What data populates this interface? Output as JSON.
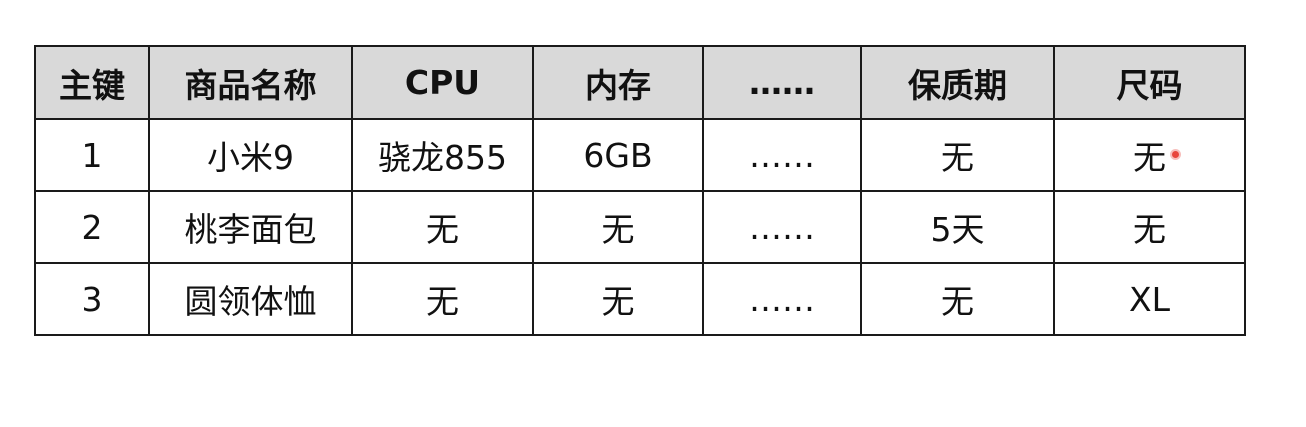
{
  "table": {
    "headers": [
      "主键",
      "商品名称",
      "CPU",
      "内存",
      "……",
      "保质期",
      "尺码"
    ],
    "rows": [
      [
        "1",
        "小米9",
        "骁龙855",
        "6GB",
        "……",
        "无",
        "无"
      ],
      [
        "2",
        "桃李面包",
        "无",
        "无",
        "……",
        "5天",
        "无"
      ],
      [
        "3",
        "圆领体恤",
        "无",
        "无",
        "……",
        "无",
        "XL"
      ]
    ]
  },
  "colors": {
    "header_background": "#d9d9d9",
    "border": "#1a1a1a",
    "cursor_marker": "#e8453c"
  }
}
